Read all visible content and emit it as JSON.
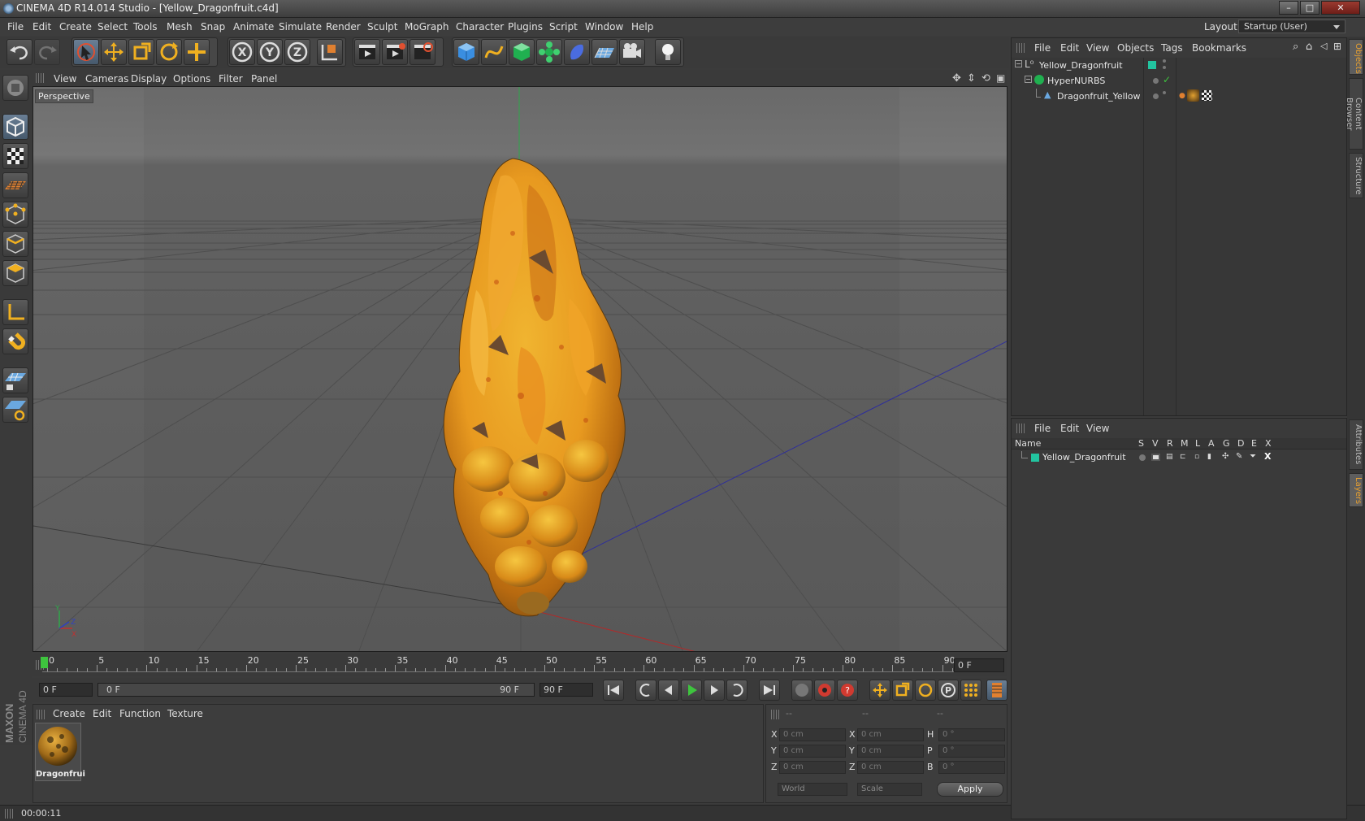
{
  "window": {
    "title": "CINEMA 4D R14.014 Studio - [Yellow_Dragonfruit.c4d]",
    "buttons": [
      "–",
      "□",
      "✕"
    ]
  },
  "menu": [
    "File",
    "Edit",
    "Create",
    "Select",
    "Tools",
    "Mesh",
    "Snap",
    "Animate",
    "Simulate",
    "Render",
    "Sculpt",
    "MoGraph",
    "Character",
    "Plugins",
    "Script",
    "Window",
    "Help"
  ],
  "layout": {
    "label": "Layout:",
    "value": "Startup (User)"
  },
  "toolbar": {
    "icons": [
      "undo-icon",
      "redo-icon",
      "live-selection-icon",
      "move-icon",
      "scale-icon",
      "rotate-icon",
      "recent-tool-icon",
      "x-axis-lock-icon",
      "y-axis-lock-icon",
      "z-axis-lock-icon",
      "coordinate-system-icon",
      "render-view-icon",
      "render-picture-viewer-icon",
      "edit-render-settings-icon",
      "cube-primitive-icon",
      "spline-pen-icon",
      "subdivision-surface-icon",
      "array-cloner-icon",
      "deformer-icon",
      "scene-floor-icon",
      "camera-icon",
      "light-icon"
    ],
    "axis_labels": [
      "X",
      "Y",
      "Z"
    ]
  },
  "left_tools": [
    "make-editable-icon",
    "model-mode-icon",
    "texture-mode-icon",
    "workplane-mode-icon",
    "points-mode-icon",
    "edges-mode-icon",
    "polygons-mode-icon",
    "axis-mode-icon",
    "snap-magnet-icon",
    "locked-workplane-icon",
    "planar-workplane-icon"
  ],
  "viewport": {
    "menu": [
      "View",
      "Cameras",
      "Display",
      "Options",
      "Filter",
      "Panel"
    ],
    "camera_label": "Perspective",
    "axis_labels": {
      "y": "Y",
      "x": "X",
      "z": "Z"
    }
  },
  "timeline": {
    "ticks": [
      "0",
      "5",
      "10",
      "15",
      "20",
      "25",
      "30",
      "35",
      "40",
      "45",
      "50",
      "55",
      "60",
      "65",
      "70",
      "75",
      "80",
      "85",
      "90"
    ],
    "current_frame": "0 F",
    "start_field": "0 F",
    "range_start": "0 F",
    "range_end": "90 F",
    "end_field": "90 F"
  },
  "material_manager": {
    "menu": [
      "Create",
      "Edit",
      "Function",
      "Texture"
    ],
    "materials": [
      {
        "name": "Dragonfrui"
      }
    ],
    "brand_top": "MAXON",
    "brand_bottom": "CINEMA 4D"
  },
  "coordinates": {
    "headers": [
      "--",
      "--",
      "--"
    ],
    "rows": [
      {
        "pos_label": "X",
        "pos": "0 cm",
        "size_label": "X",
        "size": "0 cm",
        "rot_label": "H",
        "rot": "0 °"
      },
      {
        "pos_label": "Y",
        "pos": "0 cm",
        "size_label": "Y",
        "size": "0 cm",
        "rot_label": "P",
        "rot": "0 °"
      },
      {
        "pos_label": "Z",
        "pos": "0 cm",
        "size_label": "Z",
        "size": "0 cm",
        "rot_label": "B",
        "rot": "0 °"
      }
    ],
    "mode": "World",
    "size_mode": "Scale",
    "apply": "Apply"
  },
  "object_manager": {
    "menu": [
      "File",
      "Edit",
      "View",
      "Objects",
      "Tags",
      "Bookmarks"
    ],
    "objects": [
      {
        "name": "Yellow_Dragonfruit",
        "indent": 0
      },
      {
        "name": "HyperNURBS",
        "indent": 1
      },
      {
        "name": "Dragonfruit_Yellow",
        "indent": 2
      }
    ]
  },
  "layer_manager": {
    "menu": [
      "File",
      "Edit",
      "View"
    ],
    "columns": [
      "Name",
      "S",
      "V",
      "R",
      "M",
      "L",
      "A",
      "G",
      "D",
      "E",
      "X"
    ],
    "layers": [
      {
        "name": "Yellow_Dragonfruit",
        "color": "#22c4a0"
      }
    ]
  },
  "side_tabs": [
    "Objects",
    "Content Browser",
    "Structure",
    "Attributes",
    "Layers"
  ],
  "status": {
    "time": "00:00:11"
  },
  "colors": {
    "accent": "#e8a030",
    "layer": "#22c4a0",
    "play": "#3ec43e"
  }
}
